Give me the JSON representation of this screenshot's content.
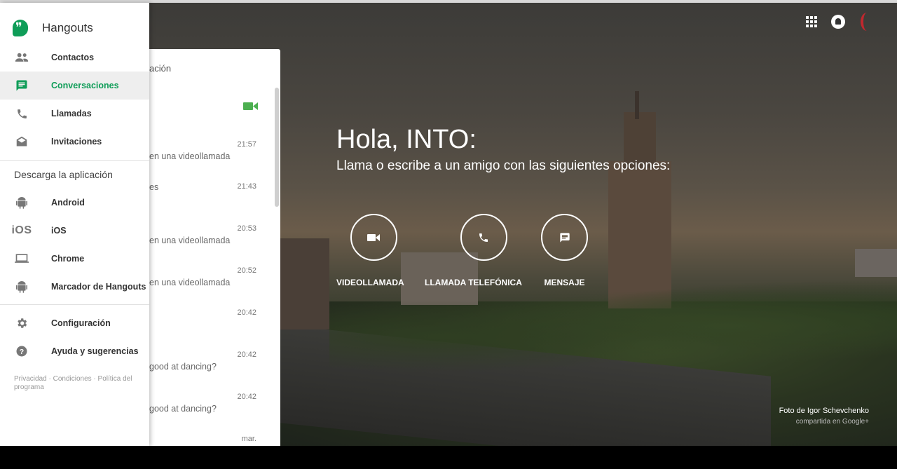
{
  "app": {
    "name": "Hangouts"
  },
  "nav": {
    "items": [
      {
        "label": "Contactos",
        "icon": "people-icon"
      },
      {
        "label": "Conversaciones",
        "icon": "message-icon",
        "active": true
      },
      {
        "label": "Llamadas",
        "icon": "phone-icon"
      },
      {
        "label": "Invitaciones",
        "icon": "envelope-icon"
      }
    ],
    "download_title": "Descarga la aplicación",
    "downloads": [
      {
        "label": "Android",
        "icon": "android-icon"
      },
      {
        "label": "iOS",
        "icon": "ios-icon",
        "icon_text": "iOS"
      },
      {
        "label": "Chrome",
        "icon": "laptop-icon"
      },
      {
        "label": "Marcador de Hangouts",
        "icon": "android-icon"
      }
    ],
    "settings": [
      {
        "label": "Configuración",
        "icon": "gear-icon"
      },
      {
        "label": "Ayuda y sugerencias",
        "icon": "help-icon"
      }
    ],
    "footer": {
      "privacy": "Privacidad",
      "sep1": " · ",
      "terms": "Condiciones",
      "sep2": " · ",
      "policy": "Política del programa"
    }
  },
  "conversations": {
    "header_fragment": "ación",
    "items": [
      {
        "time": "21:57",
        "snippet": "en una videollamada"
      },
      {
        "time": "21:43",
        "snippet": "es"
      },
      {
        "time": "20:53",
        "snippet": "en una videollamada"
      },
      {
        "time": "20:52",
        "snippet": "en una videollamada"
      },
      {
        "time": "20:42",
        "snippet": ""
      },
      {
        "time": "20:42",
        "snippet": "good at dancing?"
      },
      {
        "time": "20:42",
        "snippet": "good at dancing?"
      },
      {
        "time": "mar.",
        "snippet": ""
      }
    ]
  },
  "welcome": {
    "greeting": "Hola, INTO:",
    "subtitle": "Llama o escribe a un amigo con las siguientes opciones:"
  },
  "actions": [
    {
      "label": "VIDEOLLAMADA",
      "icon": "video-icon"
    },
    {
      "label": "LLAMADA TELEFÓNICA",
      "icon": "phone-icon"
    },
    {
      "label": "MENSAJE",
      "icon": "message-icon"
    }
  ],
  "photo_credit": {
    "line1": "Foto de Igor Schevchenko",
    "line2": "compartida en Google+"
  },
  "colors": {
    "accent": "#0f9d58",
    "video_green": "#4caf50"
  }
}
